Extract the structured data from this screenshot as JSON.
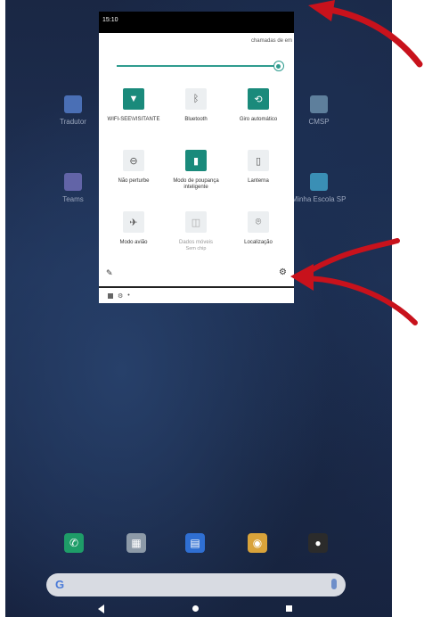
{
  "status_bar": {
    "time": "15:10"
  },
  "quick_settings": {
    "header_text": "chamadas de em",
    "brightness_level": 0.95,
    "tiles": [
      {
        "label": "WIFI-SEE\\VISITANTE",
        "sub": "",
        "icon": "wifi-icon",
        "glyph": "▼",
        "active": true,
        "disabled": false
      },
      {
        "label": "Bluetooth",
        "sub": "",
        "icon": "bluetooth-icon",
        "glyph": "ᛒ",
        "active": false,
        "disabled": false
      },
      {
        "label": "Giro automático",
        "sub": "",
        "icon": "rotate-icon",
        "glyph": "⟲",
        "active": true,
        "disabled": false
      },
      {
        "label": "Não perturbe",
        "sub": "",
        "icon": "do-not-disturb-icon",
        "glyph": "⊖",
        "active": false,
        "disabled": false
      },
      {
        "label": "Modo de poupança inteligente",
        "sub": "",
        "icon": "battery-icon",
        "glyph": "▮",
        "active": true,
        "disabled": false
      },
      {
        "label": "Lanterna",
        "sub": "",
        "icon": "flashlight-icon",
        "glyph": "▯",
        "active": false,
        "disabled": false
      },
      {
        "label": "Modo avião",
        "sub": "",
        "icon": "airplane-icon",
        "glyph": "✈",
        "active": false,
        "disabled": false
      },
      {
        "label": "Dados móveis",
        "sub": "Sem chip",
        "icon": "mobile-data-icon",
        "glyph": "◫",
        "active": false,
        "disabled": true
      },
      {
        "label": "Localização",
        "sub": "",
        "icon": "location-icon",
        "glyph": "⌾",
        "active": false,
        "disabled": false
      }
    ]
  },
  "desktop_apps": [
    {
      "label": "Tradutor",
      "icon": "translate-app-icon",
      "color": "#4a6fb5"
    },
    {
      "label": "CMSP",
      "icon": "cmsp-app-icon",
      "color": "#5e7f9c"
    },
    {
      "label": "Teams",
      "icon": "teams-app-icon",
      "color": "#6264a7"
    },
    {
      "label": "Minha Escola SP",
      "icon": "minha-escola-app-icon",
      "color": "#3a8fb5"
    }
  ],
  "dock_icons": [
    {
      "name": "phone-app-icon",
      "color": "#1e9d68",
      "glyph": "✆"
    },
    {
      "name": "calendar-app-icon",
      "color": "#8d9aa8",
      "glyph": "▦"
    },
    {
      "name": "messages-app-icon",
      "color": "#2f6fd2",
      "glyph": "▤"
    },
    {
      "name": "chrome-app-icon",
      "color": "#d9a33a",
      "glyph": "◉"
    },
    {
      "name": "camera-app-icon",
      "color": "#2b2b2b",
      "glyph": "●"
    }
  ],
  "search": {
    "logo": "G"
  },
  "colors": {
    "accent": "#1a8a7b",
    "annotation_arrow": "#c8121c"
  }
}
